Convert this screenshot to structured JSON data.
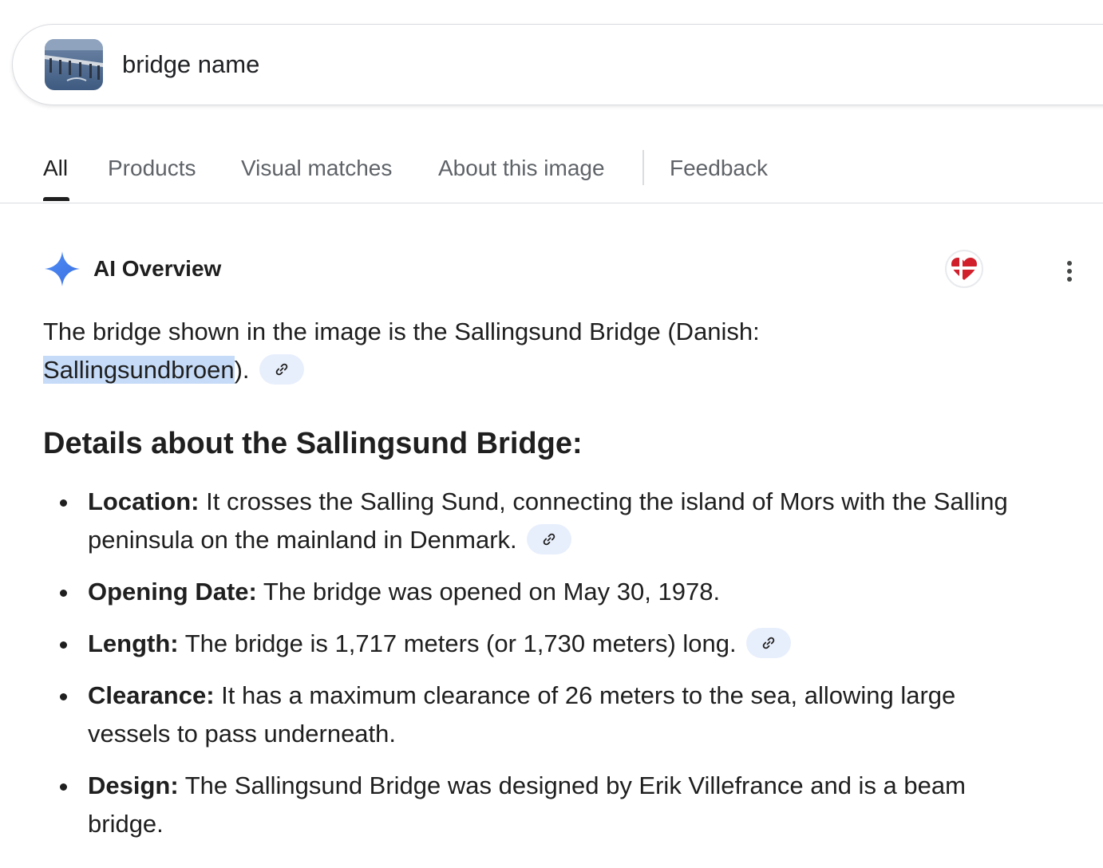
{
  "search": {
    "query": "bridge name",
    "thumbnail_icon": "bridge-image-thumbnail"
  },
  "tabs": [
    {
      "label": "All",
      "active": true
    },
    {
      "label": "Products",
      "active": false
    },
    {
      "label": "Visual matches",
      "active": false
    },
    {
      "label": "About this image",
      "active": false
    },
    {
      "label": "Feedback",
      "active": false
    }
  ],
  "ai_overview": {
    "title": "AI Overview",
    "sparkle_icon": "sparkle-icon",
    "flag_icon": "danish-flag-heart-icon",
    "more_icon": "more-vert-icon",
    "intro_part1": "The bridge shown in the image is the Sallingsund Bridge (Danish: ",
    "intro_highlight": "Sallingsundbroen",
    "intro_part2": ").",
    "details_heading": "Details about the Sallingsund Bridge:",
    "bullets": [
      {
        "label": "Location:",
        "text": " It crosses the Salling Sund, connecting the island of Mors with the Salling peninsula on the mainland in Denmark.",
        "has_citation": true
      },
      {
        "label": "Opening Date:",
        "text": " The bridge was opened on May 30, 1978.",
        "has_citation": false
      },
      {
        "label": "Length:",
        "text": " The bridge is 1,717 meters (or 1,730 meters) long.",
        "has_citation": true
      },
      {
        "label": "Clearance:",
        "text": " It has a maximum clearance of 26 meters to the sea, allowing large vessels to pass underneath.",
        "has_citation": false
      },
      {
        "label": "Design:",
        "text": " The Sallingsund Bridge was designed by Erik Villefrance and is a beam bridge.",
        "has_citation": false
      }
    ]
  },
  "colors": {
    "accent_blue": "#4285f4",
    "highlight": "#c5dbf7",
    "chip_bg": "#e8effc",
    "flag_red": "#d11f2b"
  }
}
